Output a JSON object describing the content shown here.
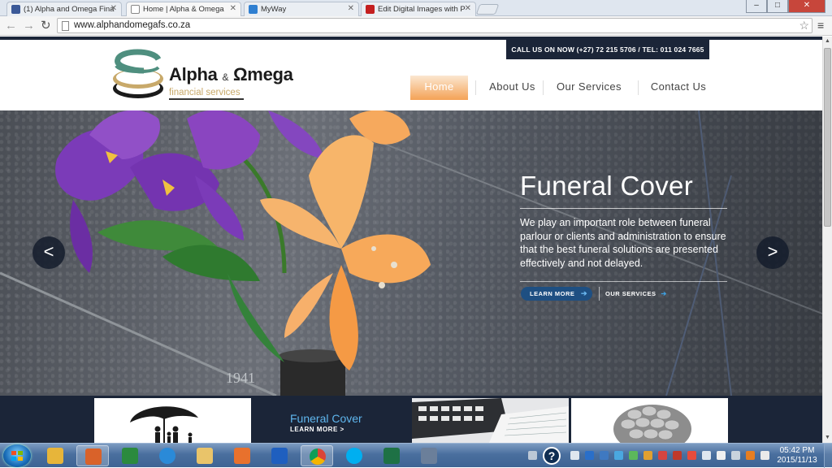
{
  "browser": {
    "tabs": [
      {
        "label": "(1) Alpha and Omega Fina",
        "icon": "facebook-icon"
      },
      {
        "label": "Home | Alpha & Omega",
        "icon": "page-icon"
      },
      {
        "label": "MyWay",
        "icon": "myway-icon"
      },
      {
        "label": "Edit Digital Images with P",
        "icon": "nch-icon"
      }
    ],
    "window_controls": {
      "minimize": "–",
      "maximize": "□",
      "close": "✕"
    },
    "url": "www.alphandomegafs.co.za"
  },
  "site": {
    "call_bar": "CALL US ON NOW (+27) 72 215 5706 / TEL: 011 024 7665",
    "logo": {
      "name_part1": "Alpha ",
      "amp": "&",
      "name_part2": " Ωmega",
      "tagline": "financial services"
    },
    "nav": [
      {
        "label": "Home",
        "active": true
      },
      {
        "label": "About Us",
        "active": false
      },
      {
        "label": "Our Services",
        "active": false
      },
      {
        "label": "Contact Us",
        "active": false
      }
    ],
    "hero": {
      "title": "Funeral Cover",
      "text": "We play an important role between funeral parlour or clients and administration to ensure that the best funeral solutions are presented effectively and not delayed.",
      "btn_learn": "LEARN MORE",
      "btn_services": "OUR SERVICES",
      "arrow_prev": "<",
      "arrow_next": ">",
      "tombstone_text": "1941"
    },
    "features": {
      "center_title": "Funeral Cover",
      "center_link": "LEARN MORE >"
    }
  },
  "taskbar": {
    "time": "05:42 PM",
    "date": "2015/11/13",
    "help_label": "?"
  },
  "colors": {
    "navy": "#1b2538",
    "accent_orange": "#f4a256",
    "link_blue": "#5fb6ee",
    "button_blue": "#1e4f82"
  }
}
